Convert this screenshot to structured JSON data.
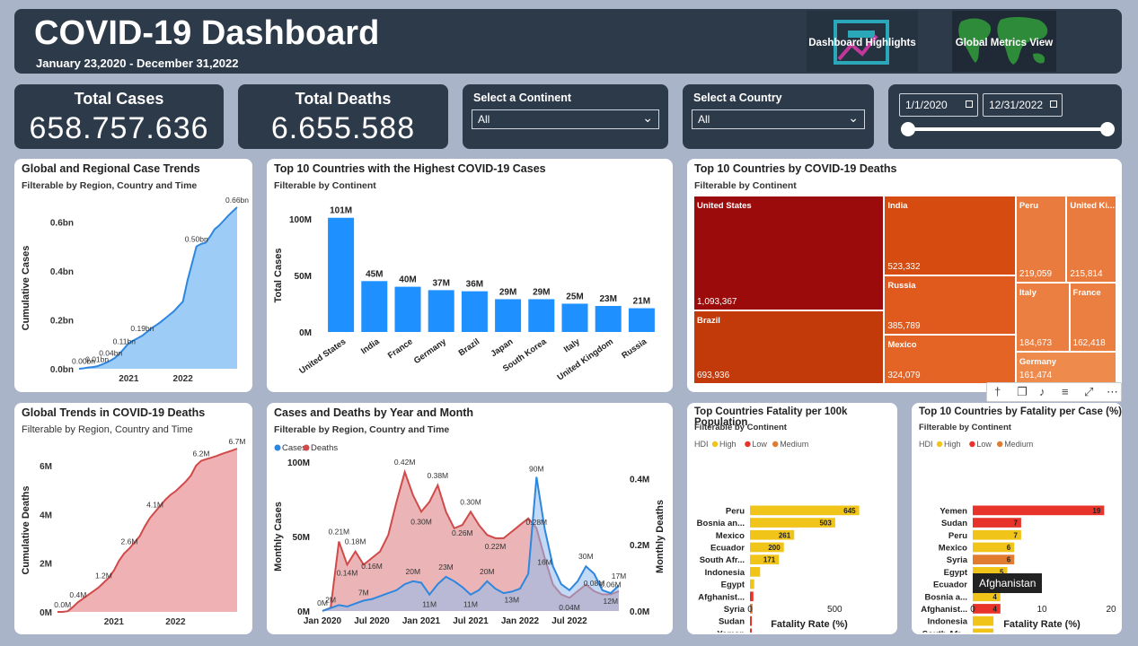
{
  "header": {
    "title": "COVID-19 Dashboard",
    "date_range": "January 23,2020 - December 31,2022",
    "nav_buttons": [
      {
        "label": "Dashboard Highlights",
        "icon": "chart-thumbnail-icon"
      },
      {
        "label": "Global Metrics View",
        "icon": "world-map-icon"
      }
    ]
  },
  "kpis": {
    "cases_label": "Total Cases",
    "cases_value": "658.757.636",
    "deaths_label": "Total Deaths",
    "deaths_value": "6.655.588"
  },
  "slicers": {
    "continent_label": "Select a Continent",
    "continent_value": "All",
    "country_label": "Select a Country",
    "country_value": "All",
    "date_start": "1/1/2020",
    "date_end": "12/31/2022"
  },
  "visual_toolbar": {
    "icons": [
      "pin-icon",
      "copy-icon",
      "bell-icon",
      "filter-icon",
      "focus-icon",
      "more-icon"
    ]
  },
  "tooltip": {
    "text": "Afghanistan"
  },
  "colors": {
    "dark_panel": "#2c3a4a",
    "bar_blue": "#1e90ff",
    "cases_line": "#2e86de",
    "deaths_line": "#d04a4a",
    "high": "#f0c419",
    "low": "#e8332a",
    "medium": "#e07b30"
  },
  "chart_data": [
    {
      "id": "case-trends",
      "type": "area",
      "title": "Global and Regional Case Trends",
      "subtitle": "Filterable by Region, Country and Time",
      "xlabel": "",
      "ylabel": "Cumulative Cases",
      "x_ticks": [
        "2021",
        "2022"
      ],
      "y_ticks": [
        "0.0bn",
        "0.2bn",
        "0.4bn",
        "0.6bn"
      ],
      "ylim": [
        0,
        0.66
      ],
      "x": [
        0,
        1,
        2,
        3,
        4,
        5,
        6,
        7,
        8,
        9,
        10,
        11,
        12,
        13,
        14,
        15,
        16,
        17,
        18,
        19,
        20,
        21,
        22,
        23,
        24,
        25,
        26,
        27,
        28,
        29,
        30,
        31,
        32,
        33,
        34,
        35
      ],
      "values": [
        0,
        0.002,
        0.005,
        0.007,
        0.01,
        0.017,
        0.025,
        0.034,
        0.045,
        0.062,
        0.083,
        0.105,
        0.115,
        0.125,
        0.135,
        0.15,
        0.165,
        0.177,
        0.19,
        0.205,
        0.22,
        0.235,
        0.255,
        0.275,
        0.36,
        0.43,
        0.5,
        0.51,
        0.515,
        0.54,
        0.57,
        0.585,
        0.605,
        0.625,
        0.643,
        0.66
      ],
      "labels": [
        {
          "i": 1,
          "text": "0.00bn"
        },
        {
          "i": 4,
          "text": "0.01bn"
        },
        {
          "i": 7,
          "text": "0.04bn"
        },
        {
          "i": 10,
          "text": "0.11bn"
        },
        {
          "i": 14,
          "text": "0.19bn"
        },
        {
          "i": 26,
          "text": "0.50bn"
        },
        {
          "i": 35,
          "text": "0.66bn"
        }
      ]
    },
    {
      "id": "top10-cases",
      "type": "bar",
      "title": "Top 10 Countries with the Highest COVID-19 Cases",
      "subtitle": "Filterable by Continent",
      "ylabel": "Total Cases",
      "y_ticks": [
        "0M",
        "50M",
        "100M"
      ],
      "ylim": [
        0,
        101
      ],
      "categories": [
        "United States",
        "India",
        "France",
        "Germany",
        "Brazil",
        "Japan",
        "South Korea",
        "Italy",
        "United Kingdom",
        "Russia"
      ],
      "values": [
        101,
        45,
        40,
        37,
        36,
        29,
        29,
        25,
        23,
        21
      ],
      "data_labels": [
        "101M",
        "45M",
        "40M",
        "37M",
        "36M",
        "29M",
        "29M",
        "25M",
        "23M",
        "21M"
      ]
    },
    {
      "id": "top10-deaths",
      "type": "treemap",
      "title": "Top 10 Countries by COVID-19 Deaths",
      "subtitle": "Filterable by Continent",
      "categories": [
        "United States",
        "Brazil",
        "India",
        "Russia",
        "Mexico",
        "Peru",
        "United Ki...",
        "Italy",
        "France",
        "Germany"
      ],
      "values": [
        1093367,
        693936,
        523332,
        385789,
        324079,
        219059,
        215814,
        184673,
        162418,
        161474
      ],
      "value_labels": [
        "1,093,367",
        "693,936",
        "523,332",
        "385,789",
        "324,079",
        "219,059",
        "215,814",
        "184,673",
        "162,418",
        "161,474"
      ]
    },
    {
      "id": "death-trends",
      "type": "area",
      "title": "Global Trends in COVID-19 Deaths",
      "subtitle": "Filterable by Region, Country and Time",
      "ylabel": "Cumulative Deaths",
      "x_ticks": [
        "2021",
        "2022"
      ],
      "y_ticks": [
        "0M",
        "2M",
        "4M",
        "6M"
      ],
      "ylim": [
        0,
        6.7
      ],
      "x": [
        0,
        1,
        2,
        3,
        4,
        5,
        6,
        7,
        8,
        9,
        10,
        11,
        12,
        13,
        14,
        15,
        16,
        17,
        18,
        19,
        20,
        21,
        22,
        23,
        24,
        25,
        26,
        27,
        28,
        29,
        30,
        31,
        32,
        33,
        34,
        35
      ],
      "values": [
        0,
        0.0,
        0.03,
        0.2,
        0.4,
        0.55,
        0.7,
        0.85,
        1.0,
        1.2,
        1.4,
        1.7,
        2.1,
        2.4,
        2.6,
        2.85,
        3.1,
        3.5,
        3.85,
        4.1,
        4.35,
        4.6,
        4.8,
        4.95,
        5.15,
        5.35,
        5.6,
        6.0,
        6.2,
        6.27,
        6.33,
        6.4,
        6.48,
        6.55,
        6.62,
        6.7
      ],
      "labels": [
        {
          "i": 1,
          "text": "0.0M"
        },
        {
          "i": 4,
          "text": "0.4M"
        },
        {
          "i": 9,
          "text": "1.2M"
        },
        {
          "i": 14,
          "text": "2.6M"
        },
        {
          "i": 19,
          "text": "4.1M"
        },
        {
          "i": 28,
          "text": "6.2M"
        },
        {
          "i": 35,
          "text": "6.7M"
        }
      ]
    },
    {
      "id": "cases-deaths-monthly",
      "type": "area",
      "title": "Cases and Deaths by Year and Month",
      "subtitle": "Filterable by Region, Country and Time",
      "legend": [
        "Cases",
        "Deaths"
      ],
      "ylabel_left": "Monthly Cases",
      "ylabel_right": "Monthly Deaths",
      "x_ticks": [
        "Jan 2020",
        "Jul 2020",
        "Jan 2021",
        "Jul 2021",
        "Jan 2022",
        "Jul 2022"
      ],
      "y_ticks_left": [
        "0M",
        "50M",
        "100M"
      ],
      "y_ticks_right": [
        "0.0M",
        "0.2M",
        "0.4M"
      ],
      "ylim_left": [
        0,
        100
      ],
      "ylim_right": [
        0,
        0.45
      ],
      "series": [
        {
          "name": "Cases",
          "values": [
            0.01,
            2,
            4,
            3,
            5,
            7,
            8,
            10,
            12,
            14,
            18,
            20,
            19,
            11,
            18,
            23,
            20,
            16,
            11,
            14,
            20,
            15,
            12,
            13,
            15,
            25,
            90,
            55,
            30,
            18,
            14,
            20,
            30,
            25,
            14,
            12,
            17
          ]
        },
        {
          "name": "Deaths",
          "values": [
            0.0,
            0.01,
            0.21,
            0.14,
            0.18,
            0.14,
            0.16,
            0.18,
            0.23,
            0.33,
            0.42,
            0.35,
            0.3,
            0.33,
            0.38,
            0.3,
            0.25,
            0.26,
            0.3,
            0.26,
            0.23,
            0.22,
            0.22,
            0.24,
            0.26,
            0.28,
            0.25,
            0.16,
            0.08,
            0.05,
            0.04,
            0.06,
            0.08,
            0.06,
            0.05,
            0.05,
            0.06
          ]
        }
      ],
      "labels": [
        {
          "series": 1,
          "i": 0,
          "text": "0M",
          "dy": -6
        },
        {
          "series": 0,
          "i": 1,
          "text": "2M",
          "dy": -6
        },
        {
          "series": 1,
          "i": 2,
          "text": "0.21M",
          "dy": -8
        },
        {
          "series": 1,
          "i": 3,
          "text": "0.14M",
          "dy": 12
        },
        {
          "series": 1,
          "i": 4,
          "text": "0.18M",
          "dy": -8
        },
        {
          "series": 1,
          "i": 6,
          "text": "0.16M",
          "dy": 12
        },
        {
          "series": 0,
          "i": 5,
          "text": "7M",
          "dy": -6
        },
        {
          "series": 1,
          "i": 10,
          "text": "0.42M",
          "dy": -8
        },
        {
          "series": 1,
          "i": 12,
          "text": "0.30M",
          "dy": 14
        },
        {
          "series": 0,
          "i": 11,
          "text": "20M",
          "dy": -8
        },
        {
          "series": 0,
          "i": 13,
          "text": "11M",
          "dy": 14
        },
        {
          "series": 1,
          "i": 14,
          "text": "0.38M",
          "dy": -8
        },
        {
          "series": 0,
          "i": 15,
          "text": "23M",
          "dy": -8
        },
        {
          "series": 0,
          "i": 18,
          "text": "11M",
          "dy": 14
        },
        {
          "series": 1,
          "i": 17,
          "text": "0.26M",
          "dy": 12
        },
        {
          "series": 1,
          "i": 18,
          "text": "0.30M",
          "dy": -8
        },
        {
          "series": 0,
          "i": 20,
          "text": "20M",
          "dy": -8
        },
        {
          "series": 1,
          "i": 21,
          "text": "0.22M",
          "dy": 12
        },
        {
          "series": 0,
          "i": 23,
          "text": "13M",
          "dy": 12
        },
        {
          "series": 0,
          "i": 26,
          "text": "90M",
          "dy": -6
        },
        {
          "series": 1,
          "i": 26,
          "text": "0.28M",
          "dy": -4
        },
        {
          "series": 0,
          "i": 27,
          "text": "16M",
          "dy": 40
        },
        {
          "series": 0,
          "i": 32,
          "text": "30M",
          "dy": -8
        },
        {
          "series": 1,
          "i": 30,
          "text": "0.04M",
          "dy": 14
        },
        {
          "series": 1,
          "i": 33,
          "text": "0.08M",
          "dy": -6
        },
        {
          "series": 0,
          "i": 36,
          "text": "17M",
          "dy": -8
        },
        {
          "series": 1,
          "i": 35,
          "text": "0.06M",
          "dy": -8
        },
        {
          "series": 0,
          "i": 35,
          "text": "12M",
          "dy": 12
        }
      ]
    },
    {
      "id": "fatality-100k",
      "type": "bar",
      "orientation": "horizontal",
      "title": "Top Countries Fatality per 100k Population",
      "subtitle": "Filterable by Continent",
      "legend_title": "HDI",
      "legend": [
        "High",
        "Low",
        "Medium"
      ],
      "xlabel": "Fatality Rate (%)",
      "x_ticks": [
        "0",
        "500"
      ],
      "xlim": [
        0,
        700
      ],
      "categories": [
        "Peru",
        "Bosnia an...",
        "Mexico",
        "Ecuador",
        "South Afr...",
        "Indonesia",
        "Egypt",
        "Afghanist...",
        "Syria",
        "Sudan",
        "Yemen"
      ],
      "values": [
        645,
        503,
        261,
        200,
        171,
        60,
        25,
        20,
        15,
        8,
        5
      ],
      "hdi": [
        "High",
        "High",
        "High",
        "High",
        "High",
        "High",
        "High",
        "Low",
        "Medium",
        "Low",
        "Low"
      ],
      "data_labels": [
        "645",
        "503",
        "261",
        "200",
        "171",
        "",
        "",
        "",
        "",
        "",
        ""
      ]
    },
    {
      "id": "fatality-per-case",
      "type": "bar",
      "orientation": "horizontal",
      "title": "Top 10 Countries by Fatality per Case (%)",
      "subtitle": "Filterable by Continent",
      "legend_title": "HDI",
      "legend": [
        "High",
        "Low",
        "Medium"
      ],
      "xlabel": "Fatality Rate (%)",
      "x_ticks": [
        "0",
        "10",
        "20"
      ],
      "xlim": [
        0,
        20
      ],
      "categories": [
        "Yemen",
        "Sudan",
        "Peru",
        "Mexico",
        "Syria",
        "Egypt",
        "Ecuador",
        "Bosnia a...",
        "Afghanist...",
        "Indonesia",
        "South Afr..."
      ],
      "values": [
        19,
        7,
        7,
        6,
        6,
        5,
        5,
        4,
        4,
        3,
        3
      ],
      "hdi": [
        "Low",
        "Low",
        "High",
        "High",
        "Medium",
        "High",
        "High",
        "High",
        "Low",
        "High",
        "High"
      ],
      "data_labels": [
        "19",
        "7",
        "7",
        "6",
        "6",
        "5",
        "5",
        "4",
        "4",
        "",
        ""
      ]
    }
  ]
}
